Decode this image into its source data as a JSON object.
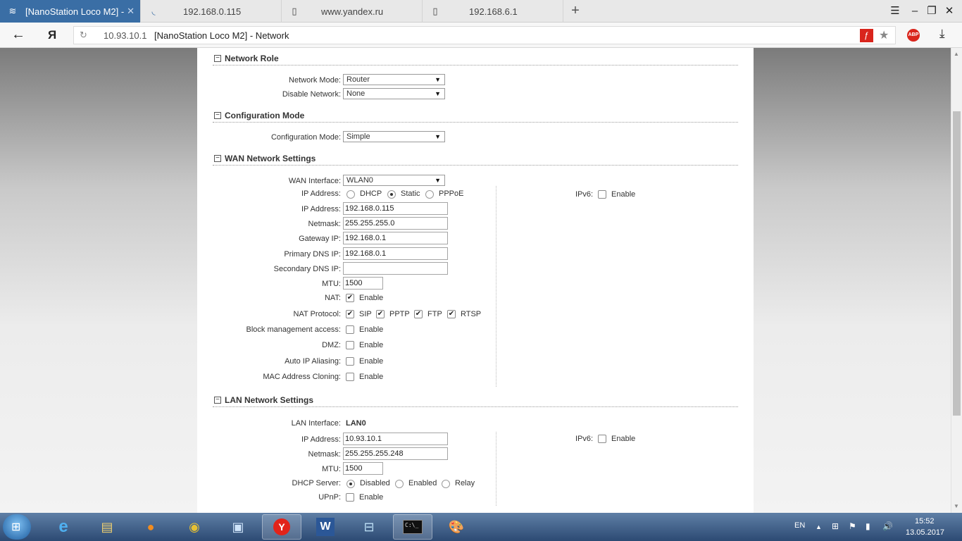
{
  "browser": {
    "tabs": [
      {
        "label": "[NanoStation Loco M2] - ",
        "icon": "airos-icon",
        "active": true
      },
      {
        "label": "192.168.0.115",
        "icon": "rss-icon",
        "active": false
      },
      {
        "label": "www.yandex.ru",
        "icon": "page-icon",
        "active": false
      },
      {
        "label": "192.168.6.1",
        "icon": "page-icon",
        "active": false
      }
    ],
    "new_tab": "+",
    "address": {
      "host": "10.93.10.1",
      "title": "[NanoStation Loco M2] - Network",
      "browser_logo": "Я"
    },
    "abp_label": "ABP"
  },
  "page": {
    "network_role": {
      "title": "Network Role",
      "network_mode_label": "Network Mode:",
      "network_mode_value": "Router",
      "disable_network_label": "Disable Network:",
      "disable_network_value": "None"
    },
    "configuration_mode": {
      "title": "Configuration Mode",
      "mode_label": "Configuration Mode:",
      "mode_value": "Simple"
    },
    "wan": {
      "title": "WAN Network Settings",
      "interface_label": "WAN Interface:",
      "interface_value": "WLAN0",
      "ip_mode_label": "IP Address:",
      "ip_modes": [
        "DHCP",
        "Static",
        "PPPoE"
      ],
      "ip_mode_selected": "Static",
      "ip_label": "IP Address:",
      "ip_value": "192.168.0.115",
      "netmask_label": "Netmask:",
      "netmask_value": "255.255.255.0",
      "gateway_label": "Gateway IP:",
      "gateway_value": "192.168.0.1",
      "pdns_label": "Primary DNS IP:",
      "pdns_value": "192.168.0.1",
      "sdns_label": "Secondary DNS IP:",
      "sdns_value": "",
      "mtu_label": "MTU:",
      "mtu_value": "1500",
      "nat_label": "NAT:",
      "enable_text": "Enable",
      "nat_protocol_label": "NAT Protocol:",
      "nat_protocols": [
        "SIP",
        "PPTP",
        "FTP",
        "RTSP"
      ],
      "block_mgmt_label": "Block management access:",
      "dmz_label": "DMZ:",
      "auto_ip_label": "Auto IP Aliasing:",
      "mac_clone_label": "MAC Address Cloning:",
      "ipv6_label": "IPv6:"
    },
    "lan": {
      "title": "LAN Network Settings",
      "interface_label": "LAN Interface:",
      "interface_value": "LAN0",
      "ip_label": "IP Address:",
      "ip_value": "10.93.10.1",
      "netmask_label": "Netmask:",
      "netmask_value": "255.255.255.248",
      "mtu_label": "MTU:",
      "mtu_value": "1500",
      "dhcp_label": "DHCP Server:",
      "dhcp_modes": [
        "Disabled",
        "Enabled",
        "Relay"
      ],
      "dhcp_selected": "Disabled",
      "upnp_label": "UPnP:",
      "enable_text": "Enable",
      "ipv6_label": "IPv6:"
    }
  },
  "taskbar": {
    "apps": [
      "ie-icon",
      "file-explorer-icon",
      "firefox-icon",
      "chrome-icon",
      "network-tool-icon",
      "yandex-browser-icon",
      "word-icon",
      "control-panel-icon",
      "cmd-icon",
      "paint-icon"
    ],
    "cmd_label": "C:\\_",
    "word_label": "W",
    "yandex_label": "Y",
    "lang": "EN",
    "time": "15:52",
    "date": "13.05.2017"
  }
}
